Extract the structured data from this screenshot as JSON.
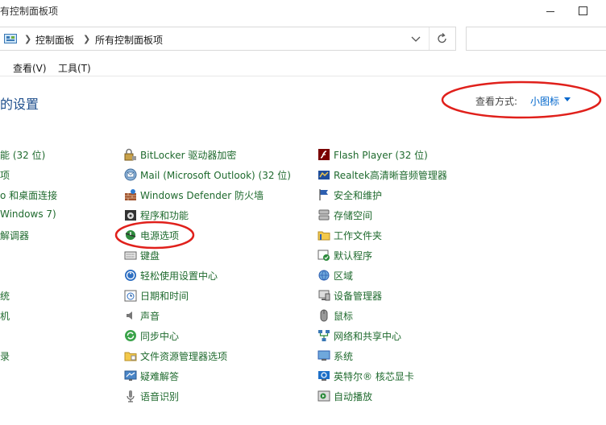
{
  "window": {
    "title": "有控制面板项"
  },
  "address_bar": {
    "crumbs": [
      "控制面板",
      "所有控制面板项"
    ]
  },
  "menu": {
    "items": [
      "查看(V)",
      "工具(T)"
    ]
  },
  "page": {
    "heading": "的设置"
  },
  "view_by": {
    "label": "查看方式:",
    "value": "小图标"
  },
  "columns": {
    "left": [
      "能 (32 位)",
      "项",
      "o 和桌面连接",
      "Windows 7)",
      "解调器",
      "",
      "",
      "统",
      "机",
      "",
      "",
      "录"
    ],
    "middle": [
      {
        "label": "BitLocker 驱动器加密",
        "icon": "bitlocker-icon"
      },
      {
        "label": "Mail (Microsoft Outlook) (32 位)",
        "icon": "mail-icon"
      },
      {
        "label": "Windows Defender 防火墙",
        "icon": "firewall-icon"
      },
      {
        "label": "程序和功能",
        "icon": "programs-icon"
      },
      {
        "label": "电源选项",
        "icon": "power-icon"
      },
      {
        "label": "键盘",
        "icon": "keyboard-icon"
      },
      {
        "label": "轻松使用设置中心",
        "icon": "ease-of-access-icon"
      },
      {
        "label": "日期和时间",
        "icon": "clock-icon"
      },
      {
        "label": "声音",
        "icon": "speaker-icon"
      },
      {
        "label": "同步中心",
        "icon": "sync-icon"
      },
      {
        "label": "文件资源管理器选项",
        "icon": "folder-options-icon"
      },
      {
        "label": "疑难解答",
        "icon": "troubleshoot-icon"
      },
      {
        "label": "语音识别",
        "icon": "microphone-icon"
      }
    ],
    "right": [
      {
        "label": "Flash Player (32 位)",
        "icon": "flash-icon"
      },
      {
        "label": "Realtek高清晰音频管理器",
        "icon": "realtek-icon"
      },
      {
        "label": "安全和维护",
        "icon": "flag-icon"
      },
      {
        "label": "存储空间",
        "icon": "storage-icon"
      },
      {
        "label": "工作文件夹",
        "icon": "work-folders-icon"
      },
      {
        "label": "默认程序",
        "icon": "default-programs-icon"
      },
      {
        "label": "区域",
        "icon": "region-icon"
      },
      {
        "label": "设备管理器",
        "icon": "device-manager-icon"
      },
      {
        "label": "鼠标",
        "icon": "mouse-icon"
      },
      {
        "label": "网络和共享中心",
        "icon": "network-icon"
      },
      {
        "label": "系统",
        "icon": "system-icon"
      },
      {
        "label": "英特尔® 核芯显卡",
        "icon": "intel-graphics-icon"
      },
      {
        "label": "自动播放",
        "icon": "autoplay-icon"
      }
    ]
  },
  "colors": {
    "link_green": "#1f6a2e",
    "heading_blue": "#1e4e8c",
    "accent_blue": "#0066cc",
    "annotation_red": "#e0201b"
  }
}
